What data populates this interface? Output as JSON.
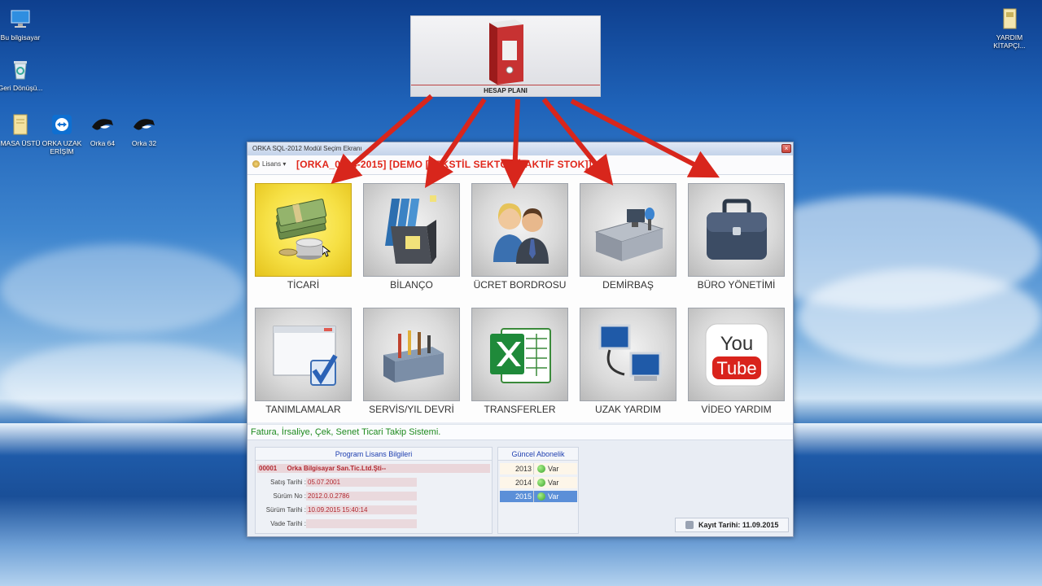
{
  "desktop": {
    "icons": [
      {
        "name": "this-pc",
        "label": "Bu bilgisayar",
        "icon": "monitor-icon"
      },
      {
        "name": "recycle-bin",
        "label": "Geri Dönüşü...",
        "icon": "recycle-bin-icon"
      },
      {
        "name": "masa-ustu",
        "label": "MASA ÜSTÜ",
        "icon": "folder-icon"
      },
      {
        "name": "orka-uzak",
        "label": "ORKA UZAK ERİŞİM",
        "icon": "teamviewer-icon"
      },
      {
        "name": "orka-64",
        "label": "Orka 64",
        "icon": "orca-icon"
      },
      {
        "name": "orka-32",
        "label": "Orka 32",
        "icon": "orca-icon"
      },
      {
        "name": "yardim",
        "label": "YARDIM KİTAPÇI...",
        "icon": "document-icon"
      }
    ]
  },
  "hesap_plani": {
    "label": "HESAP PLANI",
    "icon": "binder-icon"
  },
  "window": {
    "title": "ORKA SQL-2012 Modül Seçim Ekranı",
    "close_label": "×",
    "lisans_label": "Lisans ▾",
    "heading": "[ORKA_0504-2015] [DEMO [TEKSTİL SEKTÖRÜ AKTİF STOK]]",
    "modules": [
      {
        "label": "TİCARİ",
        "icon": "money-icon",
        "active": true
      },
      {
        "label": "BİLANÇO",
        "icon": "file-holder-icon"
      },
      {
        "label": "ÜCRET BORDROSU",
        "icon": "people-icon"
      },
      {
        "label": "DEMİRBAŞ",
        "icon": "desk-icon"
      },
      {
        "label": "BÜRO YÖNETİMİ",
        "icon": "briefcase-icon"
      },
      {
        "label": "TANIMLAMALAR",
        "icon": "window-check-icon"
      },
      {
        "label": "SERVİS/YIL DEVRİ",
        "icon": "toolbox-icon"
      },
      {
        "label": "TRANSFERLER",
        "icon": "excel-icon"
      },
      {
        "label": "UZAK YARDIM",
        "icon": "remote-computers-icon"
      },
      {
        "label": "VİDEO YARDIM",
        "icon": "youtube-icon"
      }
    ],
    "status_text": "Fatura, İrsaliye, Çek, Senet Ticari Takip Sistemi.",
    "license": {
      "title": "Program Lisans Bilgileri",
      "code": "00001",
      "company": "Orka Bilgisayar San.Tic.Ltd.Şti--",
      "rows": [
        {
          "label": "Satış Tarihi :",
          "value": "05.07.2001"
        },
        {
          "label": "Sürüm No :",
          "value": "2012.0.0.2786"
        },
        {
          "label": "Sürüm Tarihi :",
          "value": "10.09.2015 15:40:14"
        },
        {
          "label": "Vade Tarihi :",
          "value": ""
        }
      ]
    },
    "subscription": {
      "title": "Güncel Abonelik",
      "rows": [
        {
          "year": "2013",
          "status": "Var"
        },
        {
          "year": "2014",
          "status": "Var"
        },
        {
          "year": "2015",
          "status": "Var",
          "selected": true
        }
      ]
    },
    "kayit": "Kayıt Tarihi: 11.09.2015"
  },
  "colors": {
    "heading": "#e0261a",
    "status": "#1e8a1e",
    "arrow": "#d8261c",
    "active_tile": "#f6e044"
  }
}
